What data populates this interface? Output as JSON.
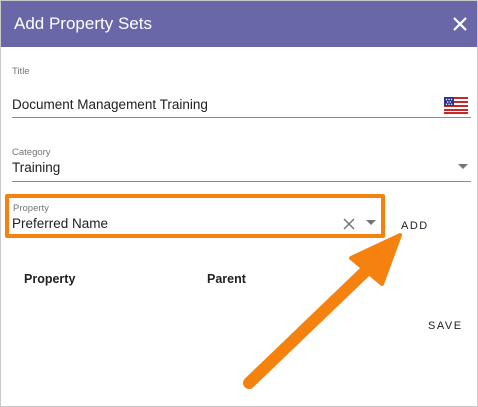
{
  "dialog": {
    "title": "Add Property Sets",
    "close_icon": "close-icon"
  },
  "form": {
    "title_label": "Title",
    "title_value": "Document Management Training",
    "language_icon": "us-flag-icon",
    "category_label": "Category",
    "category_value": "Training",
    "property_label": "Property",
    "property_value": "Preferred Name",
    "add_label": "ADD"
  },
  "table": {
    "headers": [
      "Property",
      "Parent"
    ]
  },
  "actions": {
    "save_label": "SAVE"
  },
  "colors": {
    "header": "#6a67a8",
    "highlight": "#f5820f"
  }
}
